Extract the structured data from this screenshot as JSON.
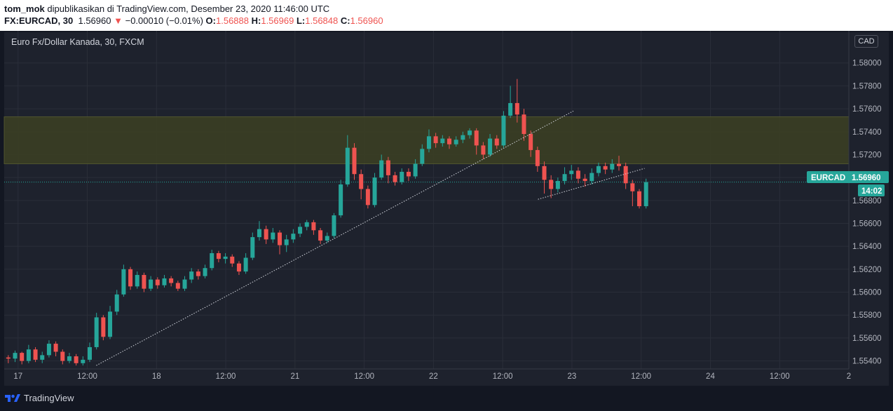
{
  "header": {
    "author": "tom_mok",
    "published_text": "dipublikasikan di TradingView.com, Desember 23, 2020 11:46:00 UTC",
    "symbol": "FX:EURCAD, 30",
    "last": "1.56960",
    "change": "−0.00010 (−0.01%)",
    "open_label": "O:",
    "open": "1.56888",
    "high_label": "H:",
    "high": "1.56969",
    "low_label": "L:",
    "low": "1.56848",
    "close_label": "C:",
    "close": "1.56960"
  },
  "chart_title": "Euro Fx/Dollar Kanada, 30, FXCM",
  "currency": "CAD",
  "symbol_tag": "EURCAD",
  "price_tag": "1.56960",
  "countdown": "14:02",
  "footer_brand": "TradingView",
  "colors": {
    "up": "#26a69a",
    "down": "#ef5350",
    "zone": "#3a3e24",
    "background": "#1e222d",
    "grid": "#2a2e39",
    "tag": "#26a69a"
  },
  "chart_data": {
    "type": "candlestick",
    "ylim": [
      1.5533,
      1.5828
    ],
    "x_range": [
      0,
      122
    ],
    "y_ticks": [
      "1.58000",
      "1.57800",
      "1.57600",
      "1.57400",
      "1.57200",
      "1.57000",
      "1.56800",
      "1.56600",
      "1.56400",
      "1.56200",
      "1.56000",
      "1.55800",
      "1.55600",
      "1.55400"
    ],
    "x_ticks": [
      {
        "x": 2,
        "label": "17"
      },
      {
        "x": 12,
        "label": "12:00"
      },
      {
        "x": 22,
        "label": "18"
      },
      {
        "x": 32,
        "label": "12:00"
      },
      {
        "x": 42,
        "label": "21"
      },
      {
        "x": 52,
        "label": "12:00"
      },
      {
        "x": 62,
        "label": "22"
      },
      {
        "x": 72,
        "label": "12:00"
      },
      {
        "x": 82,
        "label": "23"
      },
      {
        "x": 92,
        "label": "12:00"
      },
      {
        "x": 102,
        "label": "24"
      },
      {
        "x": 112,
        "label": "12:00"
      },
      {
        "x": 122,
        "label": "2"
      }
    ],
    "zone": {
      "from": 1.5712,
      "to": 1.5753
    },
    "current_price": 1.5696,
    "trendlines": [
      {
        "x1": 13.3,
        "y1": 1.5536,
        "x2": 82.2,
        "y2": 1.5758
      },
      {
        "x1": 77.1,
        "y1": 1.5681,
        "x2": 92.5,
        "y2": 1.5708
      }
    ],
    "candles": [
      [
        1.5543,
        1.5542,
        1.5545,
        1.5538
      ],
      [
        1.5542,
        1.5547,
        1.5549,
        1.5539
      ],
      [
        1.5547,
        1.554,
        1.5548,
        1.5537
      ],
      [
        1.554,
        1.555,
        1.5554,
        1.5538
      ],
      [
        1.555,
        1.5541,
        1.5552,
        1.5539
      ],
      [
        1.5541,
        1.5545,
        1.5548,
        1.5538
      ],
      [
        1.5545,
        1.5555,
        1.5558,
        1.5543
      ],
      [
        1.5555,
        1.5548,
        1.5557,
        1.5544
      ],
      [
        1.5548,
        1.554,
        1.555,
        1.5537
      ],
      [
        1.554,
        1.5544,
        1.5547,
        1.5538
      ],
      [
        1.5544,
        1.5538,
        1.5546,
        1.5536
      ],
      [
        1.5538,
        1.5541,
        1.5544,
        1.5536
      ],
      [
        1.5541,
        1.5552,
        1.5556,
        1.5539
      ],
      [
        1.5552,
        1.5578,
        1.5582,
        1.555
      ],
      [
        1.5578,
        1.5561,
        1.558,
        1.5558
      ],
      [
        1.5561,
        1.5583,
        1.5588,
        1.5559
      ],
      [
        1.5583,
        1.5598,
        1.5602,
        1.558
      ],
      [
        1.5598,
        1.562,
        1.5624,
        1.5596
      ],
      [
        1.562,
        1.5605,
        1.5622,
        1.5602
      ],
      [
        1.5605,
        1.5615,
        1.5618,
        1.5603
      ],
      [
        1.5615,
        1.5603,
        1.5617,
        1.56
      ],
      [
        1.5603,
        1.5611,
        1.5614,
        1.5601
      ],
      [
        1.5611,
        1.5606,
        1.5613,
        1.5603
      ],
      [
        1.5606,
        1.5612,
        1.5615,
        1.5604
      ],
      [
        1.5612,
        1.5608,
        1.5614,
        1.5605
      ],
      [
        1.5608,
        1.5603,
        1.561,
        1.5601
      ],
      [
        1.5603,
        1.5611,
        1.5614,
        1.5601
      ],
      [
        1.5611,
        1.5618,
        1.5621,
        1.5608
      ],
      [
        1.5618,
        1.5614,
        1.562,
        1.5611
      ],
      [
        1.5614,
        1.5621,
        1.5624,
        1.5612
      ],
      [
        1.5621,
        1.5634,
        1.5637,
        1.5619
      ],
      [
        1.5634,
        1.5629,
        1.5636,
        1.5626
      ],
      [
        1.5629,
        1.5631,
        1.5634,
        1.5625
      ],
      [
        1.5631,
        1.5625,
        1.5633,
        1.5622
      ],
      [
        1.5625,
        1.5618,
        1.5627,
        1.5615
      ],
      [
        1.5618,
        1.563,
        1.5634,
        1.5616
      ],
      [
        1.563,
        1.5648,
        1.5652,
        1.5628
      ],
      [
        1.5648,
        1.5655,
        1.5662,
        1.5645
      ],
      [
        1.5655,
        1.5646,
        1.5658,
        1.5642
      ],
      [
        1.5646,
        1.5652,
        1.5656,
        1.5643
      ],
      [
        1.5652,
        1.5641,
        1.5654,
        1.5633
      ],
      [
        1.5641,
        1.5646,
        1.565,
        1.5635
      ],
      [
        1.5646,
        1.5651,
        1.5655,
        1.5643
      ],
      [
        1.5651,
        1.5657,
        1.566,
        1.5648
      ],
      [
        1.5657,
        1.5661,
        1.5663,
        1.5654
      ],
      [
        1.5661,
        1.5654,
        1.5663,
        1.565
      ],
      [
        1.5654,
        1.5645,
        1.5656,
        1.5642
      ],
      [
        1.5645,
        1.5649,
        1.5652,
        1.5643
      ],
      [
        1.5649,
        1.5667,
        1.5669,
        1.5647
      ],
      [
        1.5667,
        1.5694,
        1.5698,
        1.5665
      ],
      [
        1.5694,
        1.5726,
        1.5737,
        1.5692
      ],
      [
        1.5726,
        1.5703,
        1.573,
        1.5698
      ],
      [
        1.5703,
        1.569,
        1.5707,
        1.5681
      ],
      [
        1.569,
        1.5676,
        1.5693,
        1.5673
      ],
      [
        1.5676,
        1.57,
        1.5704,
        1.5674
      ],
      [
        1.57,
        1.5715,
        1.572,
        1.5698
      ],
      [
        1.5715,
        1.5702,
        1.5718,
        1.5695
      ],
      [
        1.5702,
        1.5696,
        1.5705,
        1.5693
      ],
      [
        1.5696,
        1.5705,
        1.5708,
        1.5694
      ],
      [
        1.5705,
        1.5701,
        1.5708,
        1.5697
      ],
      [
        1.5701,
        1.5712,
        1.5716,
        1.5699
      ],
      [
        1.5712,
        1.5725,
        1.5729,
        1.571
      ],
      [
        1.5725,
        1.5736,
        1.5742,
        1.5722
      ],
      [
        1.5736,
        1.573,
        1.5739,
        1.5726
      ],
      [
        1.573,
        1.5734,
        1.5737,
        1.5727
      ],
      [
        1.5734,
        1.5729,
        1.5736,
        1.5725
      ],
      [
        1.5729,
        1.5733,
        1.5736,
        1.5727
      ],
      [
        1.5733,
        1.5737,
        1.574,
        1.573
      ],
      [
        1.5737,
        1.5741,
        1.5743,
        1.5734
      ],
      [
        1.5741,
        1.5728,
        1.5743,
        1.572
      ],
      [
        1.5728,
        1.572,
        1.5731,
        1.5716
      ],
      [
        1.572,
        1.5734,
        1.5738,
        1.5718
      ],
      [
        1.5734,
        1.5728,
        1.5737,
        1.5725
      ],
      [
        1.5728,
        1.5754,
        1.5758,
        1.5726
      ],
      [
        1.5754,
        1.5765,
        1.578,
        1.5752
      ],
      [
        1.5765,
        1.5755,
        1.5786,
        1.5748
      ],
      [
        1.5755,
        1.5738,
        1.576,
        1.5732
      ],
      [
        1.5738,
        1.5724,
        1.5741,
        1.5718
      ],
      [
        1.5724,
        1.571,
        1.5727,
        1.5705
      ],
      [
        1.571,
        1.5698,
        1.5714,
        1.5686
      ],
      [
        1.5698,
        1.569,
        1.5702,
        1.5682
      ],
      [
        1.569,
        1.5697,
        1.57,
        1.5687
      ],
      [
        1.5697,
        1.5703,
        1.5709,
        1.5694
      ],
      [
        1.5703,
        1.5706,
        1.5711,
        1.5698
      ],
      [
        1.5706,
        1.5699,
        1.5709,
        1.5695
      ],
      [
        1.5699,
        1.5697,
        1.5703,
        1.5692
      ],
      [
        1.5697,
        1.5704,
        1.5708,
        1.5694
      ],
      [
        1.5704,
        1.571,
        1.5713,
        1.5701
      ],
      [
        1.571,
        1.5707,
        1.5713,
        1.5703
      ],
      [
        1.5707,
        1.5712,
        1.5716,
        1.5704
      ],
      [
        1.5712,
        1.571,
        1.5719,
        1.5706
      ],
      [
        1.571,
        1.5695,
        1.5713,
        1.569
      ],
      [
        1.5695,
        1.5688,
        1.5698,
        1.5675
      ],
      [
        1.5688,
        1.5675,
        1.569,
        1.5673
      ],
      [
        1.5675,
        1.5696,
        1.5699,
        1.5673
      ]
    ]
  }
}
